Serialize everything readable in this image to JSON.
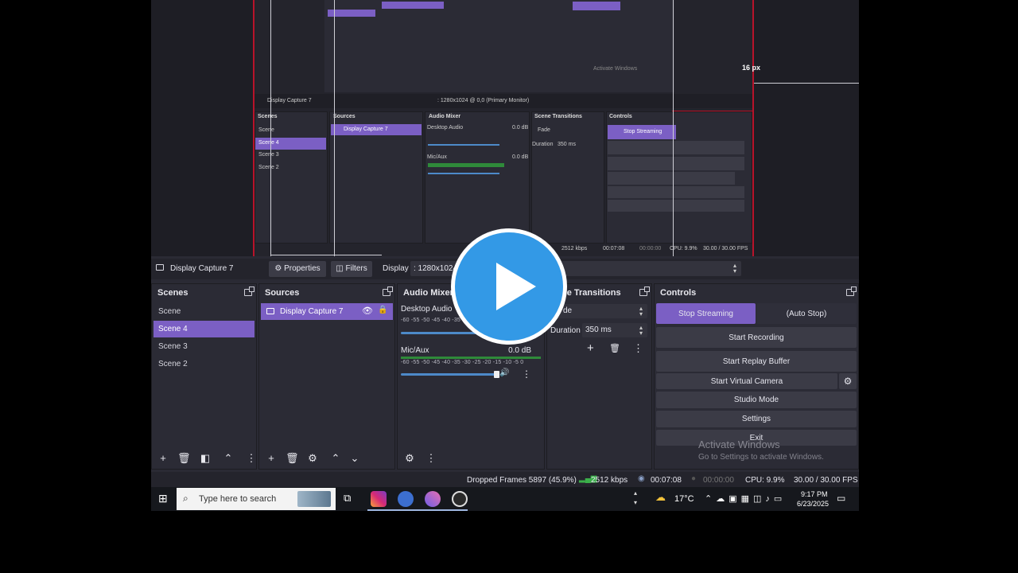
{
  "nested": {
    "scene_items": [
      "Scene",
      "Scene 4",
      "Scene 3",
      "Scene 2"
    ],
    "source_item": "Display Capture 7",
    "audio_desktop": "Desktop Audio",
    "audio_mic": "Mic/Aux",
    "db_desktop": "0.0 dB",
    "db_mic": "0.0 dB",
    "transition": "Fade",
    "duration_label": "Duration",
    "duration": "350 ms",
    "display_value": ": 1280x1024 @ 0,0 (Primary Monitor)",
    "dimension_label": "16 px",
    "stats_kbps": "2512 kbps",
    "stats_time": "00:07:08",
    "stats_rec": "00:00:00",
    "stats_cpu": "CPU: 9.9%",
    "stats_fps": "30.00 / 30.00 FPS"
  },
  "source_bar": {
    "title": "Display Capture 7",
    "properties": "Properties",
    "filters": "Filters",
    "display_label": "Display",
    "display_value": ": 1280x1024"
  },
  "panels": {
    "scenes": {
      "title": "Scenes",
      "items": [
        "Scene",
        "Scene 4",
        "Scene 3",
        "Scene 2"
      ],
      "selected": "Scene 4"
    },
    "sources": {
      "title": "Sources",
      "items": [
        "Display Capture 7"
      ]
    },
    "audio": {
      "title": "Audio Mixer",
      "channels": [
        {
          "name": "Desktop Audio",
          "db": ""
        },
        {
          "name": "Mic/Aux",
          "db": "0.0 dB"
        }
      ],
      "scale": "-60 -55 -50 -45 -40 -35 -30 -25 -20 -15 -10 -5 0"
    },
    "transitions": {
      "title": "ne Transitions",
      "type": "de",
      "duration_label": "Duration",
      "duration": "350 ms"
    },
    "controls": {
      "title": "Controls",
      "stop_streaming": "Stop Streaming",
      "auto_stop": "(Auto Stop)",
      "start_recording": "Start Recording",
      "start_replay": "Start Replay Buffer",
      "start_virtual": "Start Virtual Camera",
      "studio_mode": "Studio Mode",
      "settings": "Settings",
      "exit": "Exit"
    }
  },
  "status": {
    "dropped": "Dropped Frames 5897 (45.9%)",
    "kbps": "2512 kbps",
    "live_time": "00:07:08",
    "rec_time": "00:00:00",
    "cpu": "CPU: 9.9%",
    "fps": "30.00 / 30.00 FPS"
  },
  "watermark": {
    "line1": "Activate Windows",
    "line2": "Go to Settings to activate Windows."
  },
  "taskbar": {
    "search_placeholder": "Type here to search",
    "temperature": "17°C",
    "time": "9:17 PM",
    "date": "6/23/2025"
  },
  "colors": {
    "accent": "#7b5fc4",
    "play": "#3399e6",
    "panel": "#2b2b35"
  },
  "icons": {
    "play": "play-button-icon",
    "start": "windows-start-icon",
    "search": "search-icon"
  }
}
